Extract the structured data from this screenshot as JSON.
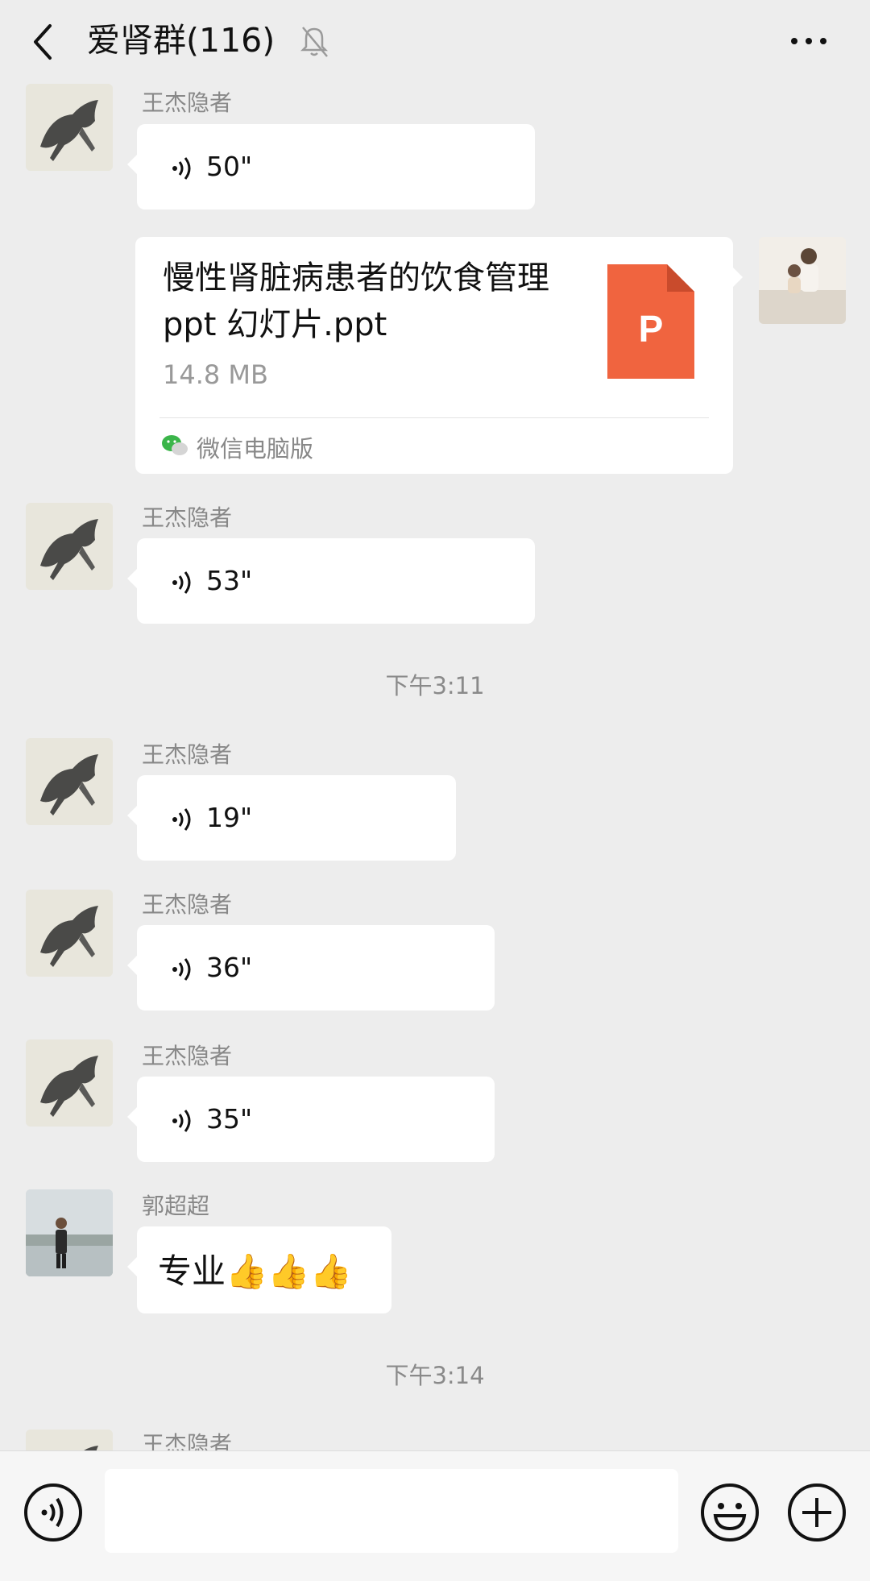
{
  "header": {
    "title": "爱肾群(116)",
    "back_icon": "chevron-left-icon",
    "mute_icon": "bell-off-icon",
    "more_icon": "ellipsis-icon"
  },
  "messages": [
    {
      "type": "voice",
      "sender": "王杰隐者",
      "duration": "50\""
    },
    {
      "type": "file",
      "side": "right",
      "file_name": "慢性肾脏病患者的饮食管理 ppt 幻灯片.ppt",
      "file_size": "14.8 MB",
      "file_icon_letter": "P",
      "source": "微信电脑版"
    },
    {
      "type": "voice",
      "sender": "王杰隐者",
      "duration": "53\""
    },
    {
      "type": "time",
      "text": "下午3:11"
    },
    {
      "type": "voice",
      "sender": "王杰隐者",
      "duration": "19\""
    },
    {
      "type": "voice",
      "sender": "王杰隐者",
      "duration": "36\""
    },
    {
      "type": "voice",
      "sender": "王杰隐者",
      "duration": "35\""
    },
    {
      "type": "text",
      "sender": "郭超超",
      "text": "专业👍👍👍"
    },
    {
      "type": "time",
      "text": "下午3:14"
    },
    {
      "type": "voice",
      "sender": "王杰隐者",
      "duration": ""
    }
  ],
  "input_bar": {
    "voice_icon": "voice-icon",
    "emoji_icon": "emoji-icon",
    "plus_icon": "plus-icon",
    "placeholder": ""
  },
  "colors": {
    "background": "#ededed",
    "bubble": "#ffffff",
    "ppt_icon": "#f0643f"
  }
}
